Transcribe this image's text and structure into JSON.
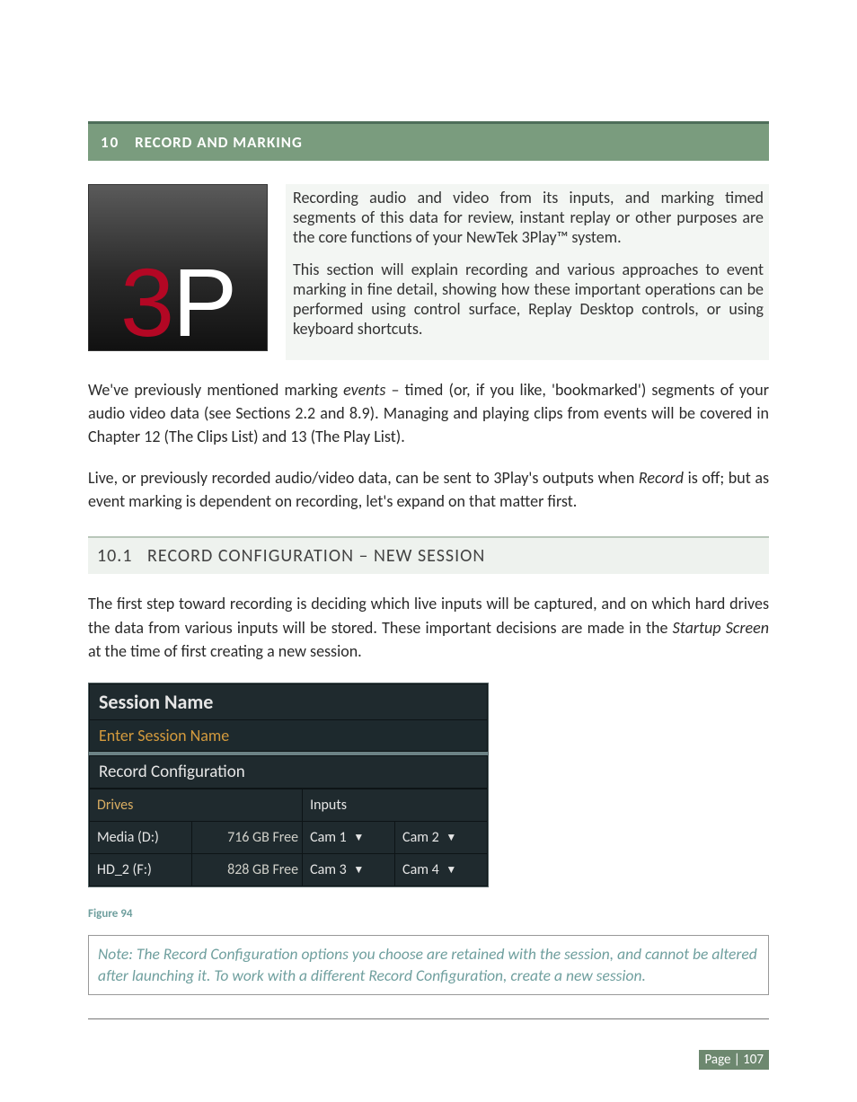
{
  "section": {
    "number": "10",
    "title": "RECORD AND MARKING"
  },
  "logo": {
    "left": "3",
    "right": "P"
  },
  "intro": {
    "p1": "Recording audio and video from its inputs, and marking timed segments of this data for review, instant replay or other purposes are the core functions of your NewTek 3Play™ system.",
    "p2": "This section will explain recording and various approaches to event marking in fine detail, showing how these important operations can be performed using control surface, Replay Desktop controls, or using keyboard shortcuts."
  },
  "body": {
    "p1a": "We've previously mentioned marking ",
    "p1_em": "events",
    "p1b": " – timed (or, if you like, 'bookmarked') segments of your audio video data (see Sections 2.2 and 8.9).  Managing and playing clips from events will be covered in Chapter 12 (The Clips List) and 13 (The Play List).",
    "p2a": "Live, or previously recorded audio/video data, can be sent to 3Play's outputs when ",
    "p2_em": "Record",
    "p2b": " is off; but as event marking is dependent on recording, let's expand on that matter first."
  },
  "subsection": {
    "number": "10.1",
    "title": "RECORD CONFIGURATION – NEW SESSION"
  },
  "body2": {
    "p1a": "The first step toward recording is deciding which live inputs will be captured, and on which hard drives the data from various inputs will be stored.  These important decisions are made in the ",
    "p1_em": "Startup Screen",
    "p1b": " at the time of first creating a new session."
  },
  "config": {
    "session_label": "Session Name",
    "session_placeholder": "Enter Session Name",
    "record_label": "Record Configuration",
    "headers": {
      "drives": "Drives",
      "inputs": "Inputs"
    },
    "rows": [
      {
        "drive": "Media (D:)",
        "free": "716 GB Free",
        "camA": "Cam 1",
        "camB": "Cam 2"
      },
      {
        "drive": "HD_2 (F:)",
        "free": "828 GB Free",
        "camA": "Cam 3",
        "camB": "Cam 4"
      }
    ]
  },
  "figure": "Figure 94",
  "note": "Note: The Record Configuration options you choose are retained with the session, and cannot be altered after launching it.  To work with a different Record Configuration, create a new session.",
  "footer": "Page | 107"
}
